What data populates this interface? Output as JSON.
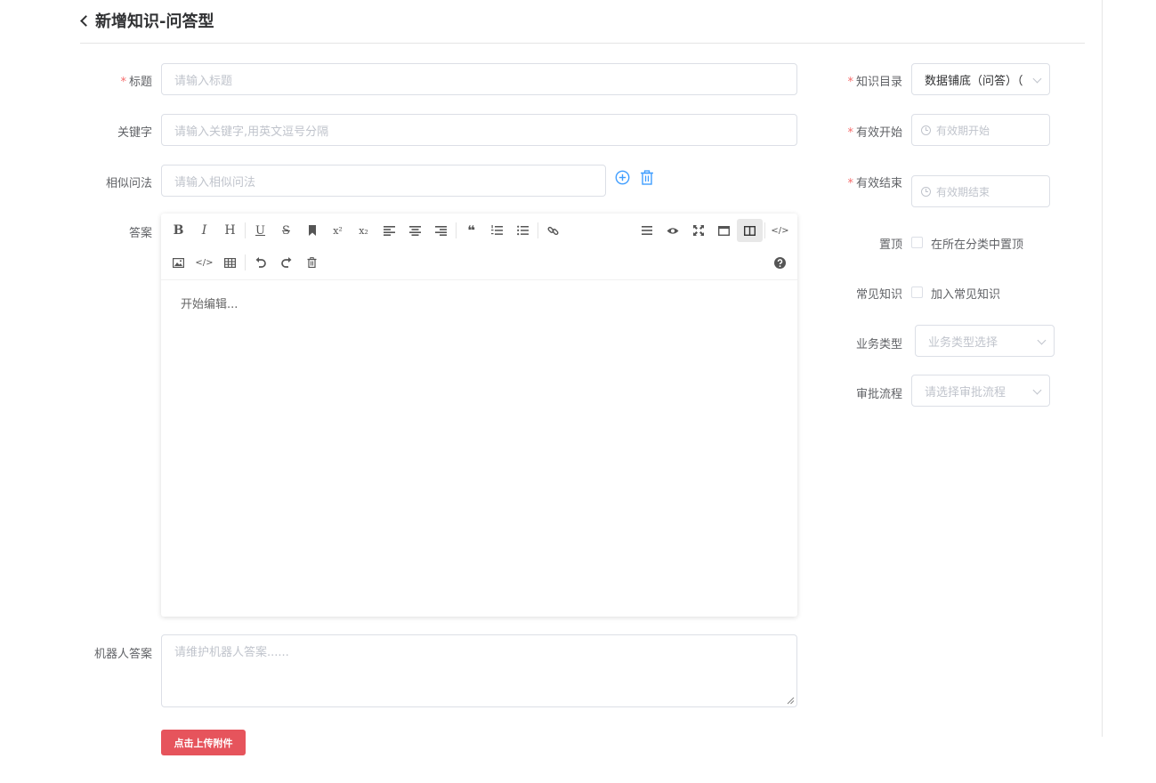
{
  "header": {
    "title": "新增知识-问答型"
  },
  "form": {
    "title": {
      "label": "标题",
      "placeholder": "请输入标题"
    },
    "keywords": {
      "label": "关键字",
      "placeholder": "请输入关键字,用英文逗号分隔"
    },
    "similar": {
      "label": "相似问法",
      "placeholder": "请输入相似问法"
    },
    "answer": {
      "label": "答案",
      "editor_placeholder": "开始编辑..."
    },
    "robot_answer": {
      "label": "机器人答案",
      "placeholder": "请维护机器人答案......"
    },
    "upload_label": "点击上传附件"
  },
  "side": {
    "directory": {
      "label": "知识目录",
      "value": "数据铺底（问答）（"
    },
    "valid_start": {
      "label": "有效开始",
      "placeholder": "有效期开始"
    },
    "valid_end": {
      "label": "有效结束",
      "placeholder": "有效期结束"
    },
    "pin": {
      "label": "置顶",
      "option": "在所在分类中置顶",
      "checked": false
    },
    "common": {
      "label": "常见知识",
      "option": "加入常见知识",
      "checked": false
    },
    "biz_type": {
      "label": "业务类型",
      "placeholder": "业务类型选择"
    },
    "approval": {
      "label": "审批流程",
      "placeholder": "请选择审批流程"
    }
  },
  "toolbar": {
    "bold": "B",
    "italic": "I",
    "header": "H",
    "underline": "U",
    "strike": "S",
    "superscript": "x²",
    "subscript": "x₂",
    "quote": "❝",
    "code": "</>",
    "code_block": "</>"
  },
  "colors": {
    "accent": "#409eff",
    "danger": "#e6545c",
    "required": "#f56c6c"
  }
}
